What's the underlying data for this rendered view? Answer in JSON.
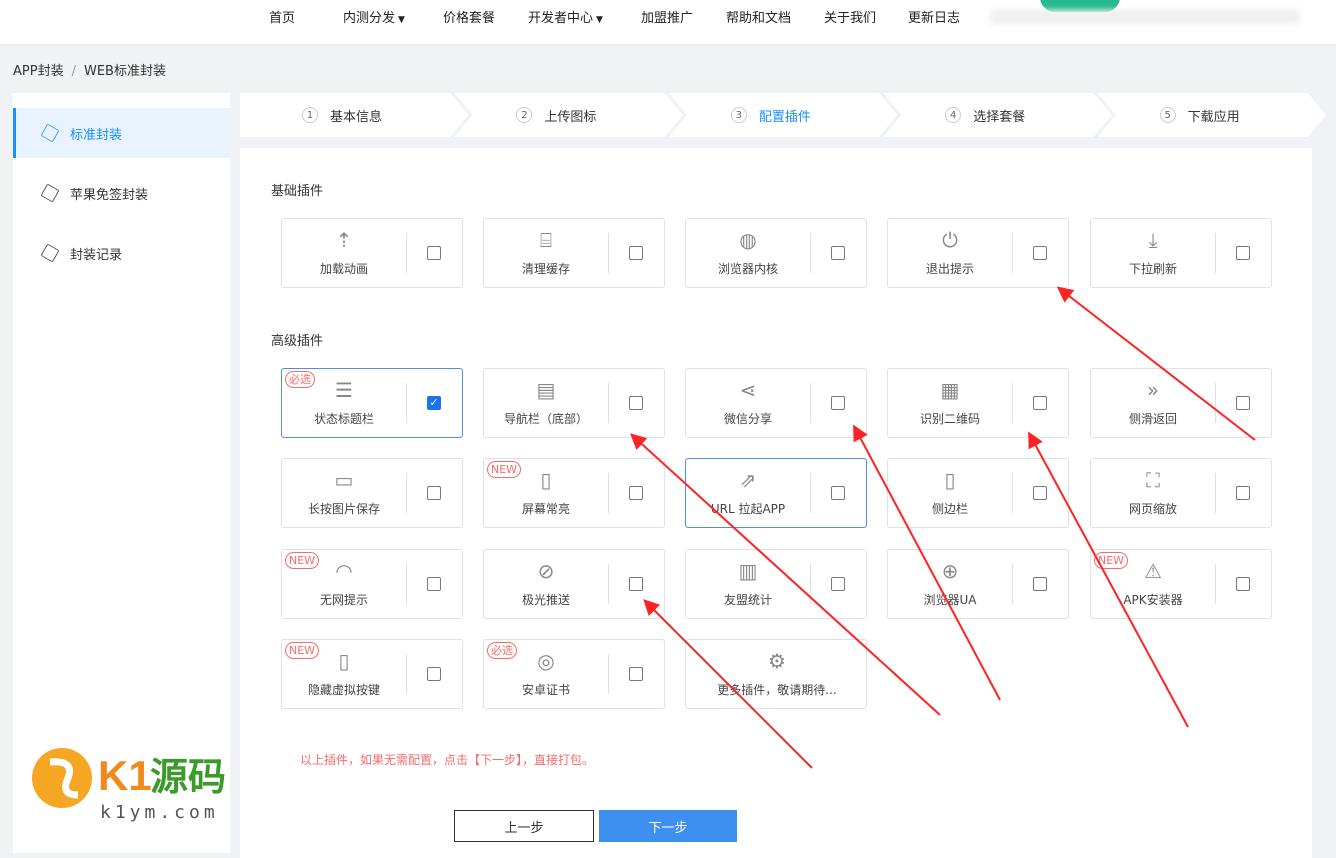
{
  "nav": [
    {
      "label": "首页"
    },
    {
      "label": "内测分发",
      "dropdown": true
    },
    {
      "label": "价格套餐"
    },
    {
      "label": "开发者中心",
      "dropdown": true
    },
    {
      "label": "加盟推广"
    },
    {
      "label": "帮助和文档"
    },
    {
      "label": "关于我们"
    },
    {
      "label": "更新日志"
    }
  ],
  "breadcrumb": [
    "APP封装",
    "WEB标准封装"
  ],
  "sidebar": [
    {
      "label": "标准封装",
      "active": true
    },
    {
      "label": "苹果免签封装"
    },
    {
      "label": "封装记录"
    }
  ],
  "steps": [
    {
      "n": "1",
      "label": "基本信息"
    },
    {
      "n": "2",
      "label": "上传图标"
    },
    {
      "n": "3",
      "label": "配置插件",
      "active": true
    },
    {
      "n": "4",
      "label": "选择套餐"
    },
    {
      "n": "5",
      "label": "下载应用"
    }
  ],
  "basic": {
    "title": "基础插件",
    "items": [
      {
        "label": "加载动画",
        "icon": "upload-icon",
        "glyph": "⇡"
      },
      {
        "label": "清理缓存",
        "icon": "broom-icon",
        "glyph": "⌸"
      },
      {
        "label": "浏览器内核",
        "icon": "planet-icon",
        "glyph": "◍"
      },
      {
        "label": "退出提示",
        "icon": "power-icon",
        "glyph": "⏻"
      },
      {
        "label": "下拉刷新",
        "icon": "pull-down-icon",
        "glyph": "⤓"
      }
    ]
  },
  "advanced": {
    "title": "高级插件",
    "items": [
      {
        "label": "状态标题栏",
        "icon": "menu-circle-icon",
        "glyph": "☰",
        "badge": "必选",
        "checked": true,
        "selected": true
      },
      {
        "label": "导航栏（底部）",
        "icon": "document-icon",
        "glyph": "▤"
      },
      {
        "label": "微信分享",
        "icon": "share-icon",
        "glyph": "⋖"
      },
      {
        "label": "识别二维码",
        "icon": "qrcode-icon",
        "glyph": "▦"
      },
      {
        "label": "侧滑返回",
        "icon": "double-chevron-icon",
        "glyph": "»"
      },
      {
        "label": "长按图片保存",
        "icon": "save-icon",
        "glyph": "▭"
      },
      {
        "label": "屏幕常亮",
        "icon": "phone-brightness-icon",
        "glyph": "▯",
        "badge": "NEW"
      },
      {
        "label": "URL 拉起APP",
        "icon": "external-share-icon",
        "glyph": "⇗",
        "selected": true
      },
      {
        "label": "侧边栏",
        "icon": "sidebar-icon",
        "glyph": "▯"
      },
      {
        "label": "网页缩放",
        "icon": "zoom-icon",
        "glyph": "⛶"
      },
      {
        "label": "无网提示",
        "icon": "wifi-alert-icon",
        "glyph": "◠",
        "badge": "NEW"
      },
      {
        "label": "极光推送",
        "icon": "push-icon",
        "glyph": "⊘"
      },
      {
        "label": "友盟统计",
        "icon": "bar-chart-icon",
        "glyph": "▥"
      },
      {
        "label": "浏览器UA",
        "icon": "globe-icon",
        "glyph": "⊕"
      },
      {
        "label": "APK安装器",
        "icon": "apk-installer-icon",
        "glyph": "⚠",
        "badge": "NEW"
      },
      {
        "label": "隐藏虚拟按键",
        "icon": "phone-icon",
        "glyph": "▯",
        "badge": "NEW"
      },
      {
        "label": "安卓证书",
        "icon": "android-icon",
        "glyph": "◎",
        "badge": "必选"
      },
      {
        "label": "更多插件，敬请期待...",
        "icon": "gear-icon",
        "glyph": "⚙",
        "nocheck": true
      }
    ]
  },
  "note": "以上插件，如果无需配置，点击【下一步】，直接打包。",
  "buttons": {
    "prev": "上一步",
    "next": "下一步"
  },
  "watermark": {
    "text": "K1源码",
    "url": "k1ym.com"
  },
  "colors": {
    "accent": "#1890ff",
    "primary_button": "#3d8ff0",
    "warning": "#f56c6c"
  }
}
